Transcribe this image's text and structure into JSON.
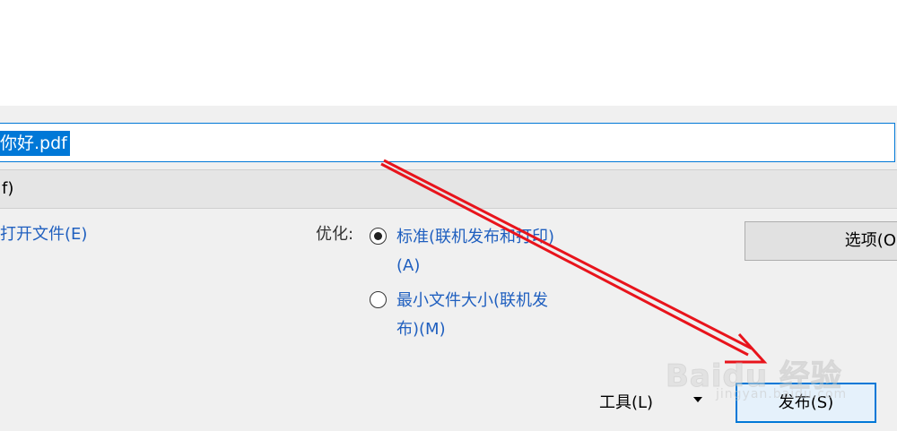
{
  "dialog": {
    "filename": "你好.pdf",
    "filetype": "f)",
    "open_after_publish": "打开文件(E)",
    "optimize_label": "优化:",
    "optimize_options": [
      {
        "lines": [
          "标准(联机发布和打印)",
          "(A)"
        ],
        "checked": true
      },
      {
        "lines": [
          "最小文件大小(联机发",
          "布)(M)"
        ],
        "checked": false
      }
    ],
    "options_button": "选项(O",
    "tools_button": "工具(L)",
    "publish_button": "发布(S)"
  },
  "annotation": {
    "arrow_color": "#e8141c"
  },
  "watermark": {
    "brand": "Baidu 经验",
    "sub": "jingyan.baidu.com"
  }
}
